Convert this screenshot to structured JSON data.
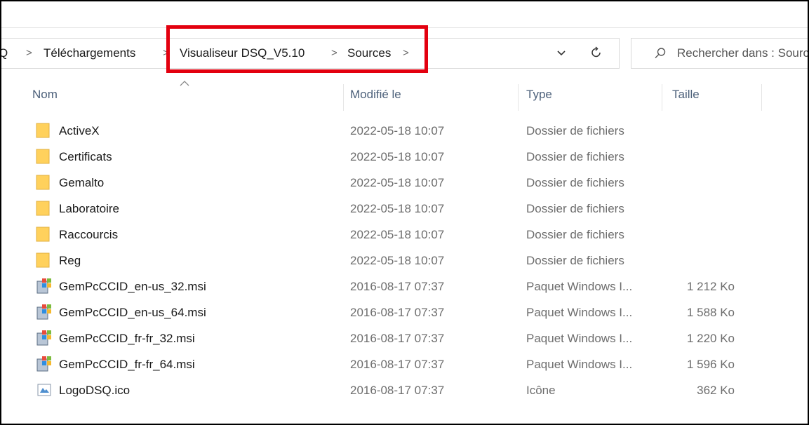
{
  "colors": {
    "highlight": "#e3000f",
    "folder": "#ffd15c",
    "header_text": "#4c607a"
  },
  "breadcrumb": {
    "items": [
      "Q",
      "Téléchargements",
      "Visualiseur DSQ_V5.10",
      "Sources"
    ],
    "separator": ">"
  },
  "address_controls": {
    "dropdown_icon": "chevron-down-icon",
    "refresh_icon": "refresh-icon"
  },
  "search": {
    "placeholder": "Rechercher dans : Sources"
  },
  "columns": {
    "name": "Nom",
    "modified": "Modifié le",
    "type": "Type",
    "size": "Taille"
  },
  "files": [
    {
      "name": "ActiveX",
      "modified": "2022-05-18 10:07",
      "type": "Dossier de fichiers",
      "size": "",
      "icon": "folder-icon"
    },
    {
      "name": "Certificats",
      "modified": "2022-05-18 10:07",
      "type": "Dossier de fichiers",
      "size": "",
      "icon": "folder-icon"
    },
    {
      "name": "Gemalto",
      "modified": "2022-05-18 10:07",
      "type": "Dossier de fichiers",
      "size": "",
      "icon": "folder-icon"
    },
    {
      "name": "Laboratoire",
      "modified": "2022-05-18 10:07",
      "type": "Dossier de fichiers",
      "size": "",
      "icon": "folder-icon"
    },
    {
      "name": "Raccourcis",
      "modified": "2022-05-18 10:07",
      "type": "Dossier de fichiers",
      "size": "",
      "icon": "folder-icon"
    },
    {
      "name": "Reg",
      "modified": "2022-05-18 10:07",
      "type": "Dossier de fichiers",
      "size": "",
      "icon": "folder-icon"
    },
    {
      "name": "GemPcCCID_en-us_32.msi",
      "modified": "2016-08-17 07:37",
      "type": "Paquet Windows I...",
      "size": "1 212 Ko",
      "icon": "msi-package-icon"
    },
    {
      "name": "GemPcCCID_en-us_64.msi",
      "modified": "2016-08-17 07:37",
      "type": "Paquet Windows I...",
      "size": "1 588 Ko",
      "icon": "msi-package-icon"
    },
    {
      "name": "GemPcCCID_fr-fr_32.msi",
      "modified": "2016-08-17 07:37",
      "type": "Paquet Windows I...",
      "size": "1 220 Ko",
      "icon": "msi-package-icon"
    },
    {
      "name": "GemPcCCID_fr-fr_64.msi",
      "modified": "2016-08-17 07:37",
      "type": "Paquet Windows I...",
      "size": "1 596 Ko",
      "icon": "msi-package-icon"
    },
    {
      "name": "LogoDSQ.ico",
      "modified": "2016-08-17 07:37",
      "type": "Icône",
      "size": "362 Ko",
      "icon": "ico-file-icon"
    }
  ]
}
